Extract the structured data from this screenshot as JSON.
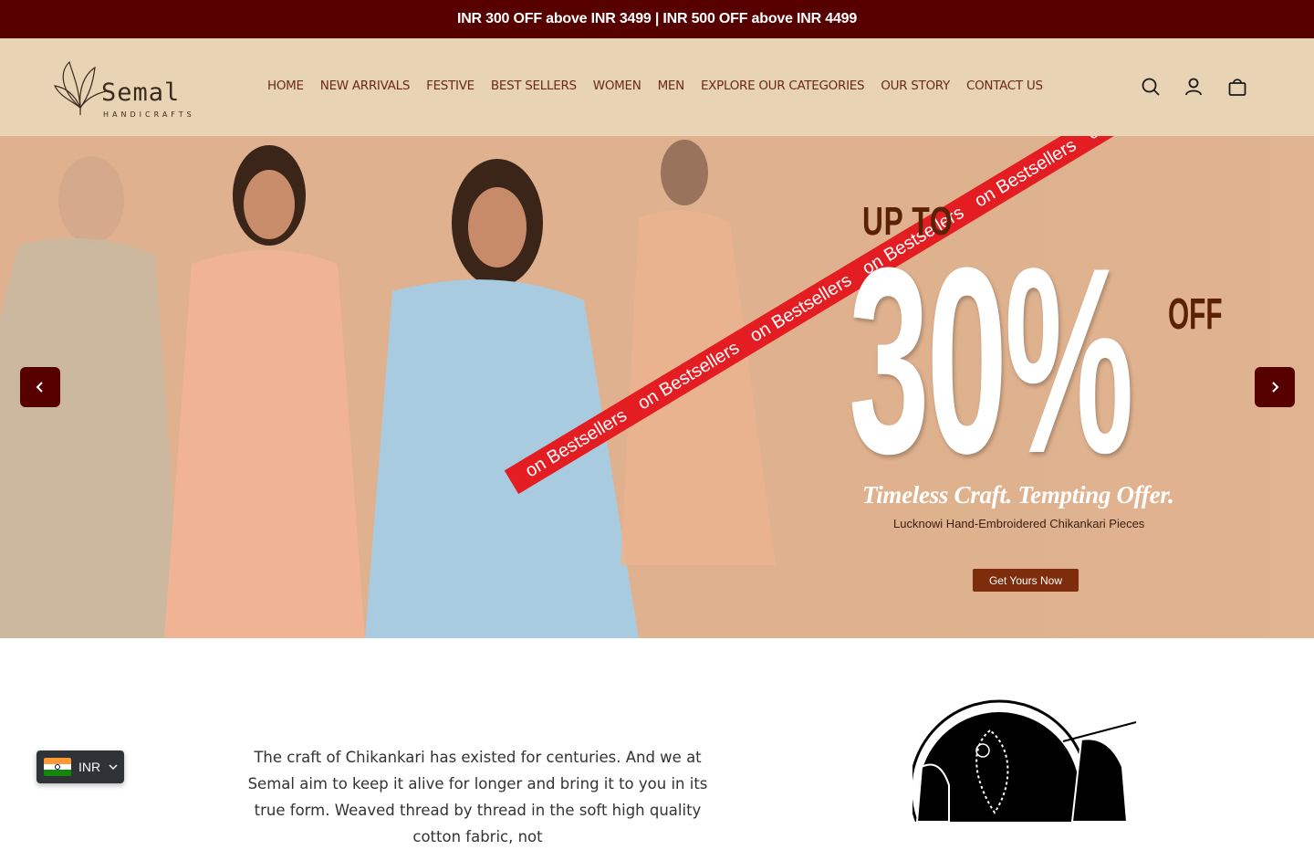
{
  "announcement": "INR 300 OFF above INR 3499 | INR 500 OFF above INR 4499",
  "brand": {
    "name": "Semal",
    "tagline": "HANDICRAFTS"
  },
  "nav": [
    "HOME",
    "NEW ARRIVALS",
    "FESTIVE",
    "BEST SELLERS",
    "WOMEN",
    "MEN",
    "EXPLORE OUR CATEGORIES",
    "OUR STORY",
    "CONTACT US"
  ],
  "header_icons": [
    "search-icon",
    "account-icon",
    "cart-icon"
  ],
  "hero": {
    "upto": "UP TO",
    "percent": "30%",
    "off": "OFF",
    "ribbon_text": "on Bestsellers",
    "tagline": "Timeless Craft. Tempting Offer.",
    "subtitle": "Lucknowi Hand-Embroidered Chikankari Pieces",
    "cta": "Get Yours Now"
  },
  "intro": "The craft of Chikankari has existed for centuries. And we at Semal aim to keep it alive for longer and bring it to you in its true form. Weaved thread by thread in the soft high quality cotton fabric, not",
  "currency": {
    "code": "INR"
  },
  "colors": {
    "announce_bg": "#560000",
    "header_bg": "#e8d3b4",
    "nav_text": "#6b2b16",
    "ribbon": "#e31d22"
  }
}
